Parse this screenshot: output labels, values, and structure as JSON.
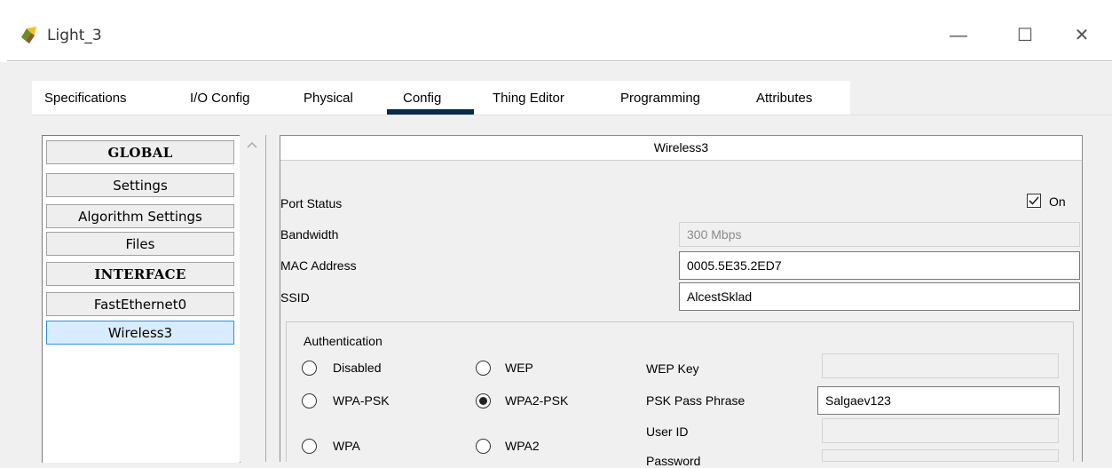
{
  "window": {
    "title": "Light_3",
    "minimize_glyph": "—",
    "maximize_glyph": "☐",
    "close_glyph": "✕"
  },
  "tabs": [
    {
      "label": "Specifications"
    },
    {
      "label": "I/O Config"
    },
    {
      "label": "Physical"
    },
    {
      "label": "Config",
      "active": true
    },
    {
      "label": "Thing Editor"
    },
    {
      "label": "Programming"
    },
    {
      "label": "Attributes"
    }
  ],
  "sidebar": {
    "items": [
      {
        "label": "GLOBAL",
        "type": "header"
      },
      {
        "label": "Settings"
      },
      {
        "label": "Algorithm Settings"
      },
      {
        "label": "Files"
      },
      {
        "label": "INTERFACE",
        "type": "header"
      },
      {
        "label": "FastEthernet0"
      },
      {
        "label": "Wireless3",
        "selected": true
      }
    ]
  },
  "panel": {
    "title": "Wireless3",
    "port_status_label": "Port Status",
    "port_status_on": true,
    "port_status_on_label": "On",
    "bandwidth_label": "Bandwidth",
    "bandwidth_value": "300 Mbps",
    "mac_label": "MAC Address",
    "mac_value": "0005.5E35.2ED7",
    "ssid_label": "SSID",
    "ssid_value": "AlcestSklad"
  },
  "auth": {
    "title": "Authentication",
    "options": [
      "Disabled",
      "WEP",
      "WPA-PSK",
      "WPA2-PSK",
      "WPA",
      "WPA2"
    ],
    "selected": "WPA2-PSK",
    "wep_key_label": "WEP Key",
    "wep_key_value": "",
    "psk_label": "PSK Pass Phrase",
    "psk_value": "Salgaev123",
    "user_id_label": "User ID",
    "user_id_value": "",
    "password_label": "Password"
  },
  "colors": {
    "tab_underline": "#0a2a4c",
    "selected_item_bg": "#d9ecff",
    "selected_item_border": "#2e8fe6"
  }
}
